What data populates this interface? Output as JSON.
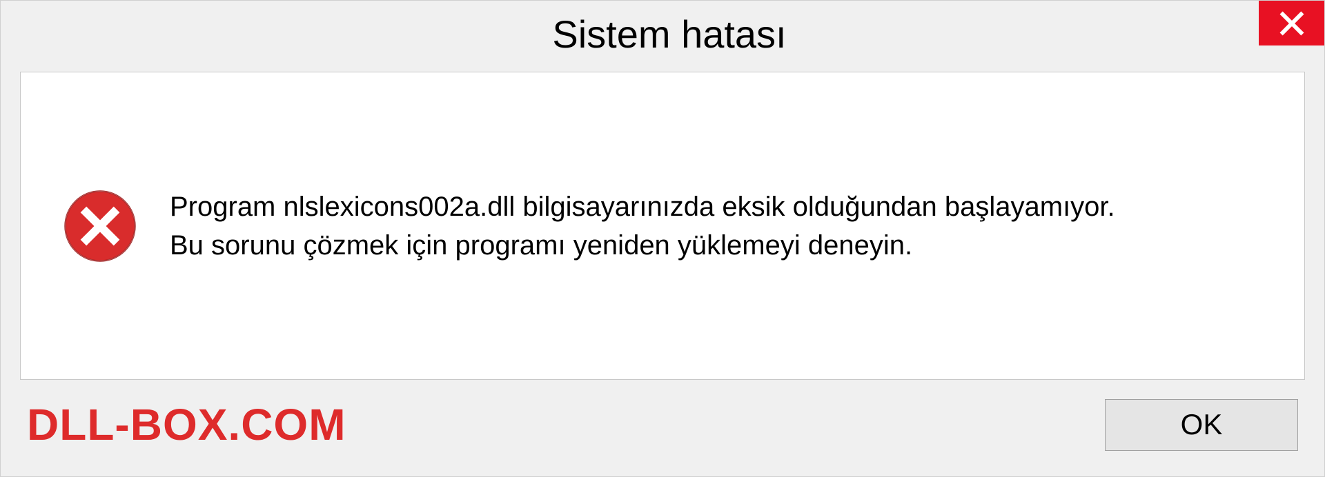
{
  "titlebar": {
    "title": "Sistem hatası"
  },
  "message": {
    "line1": "Program nlslexicons002a.dll bilgisayarınızda eksik olduğundan başlayamıyor.",
    "line2": "Bu sorunu çözmek için programı yeniden yüklemeyi deneyin."
  },
  "footer": {
    "watermark": "DLL-BOX.COM",
    "ok_label": "OK"
  },
  "colors": {
    "close_button": "#e81123",
    "error_icon": "#d92c2c",
    "watermark": "#de2b2b"
  }
}
